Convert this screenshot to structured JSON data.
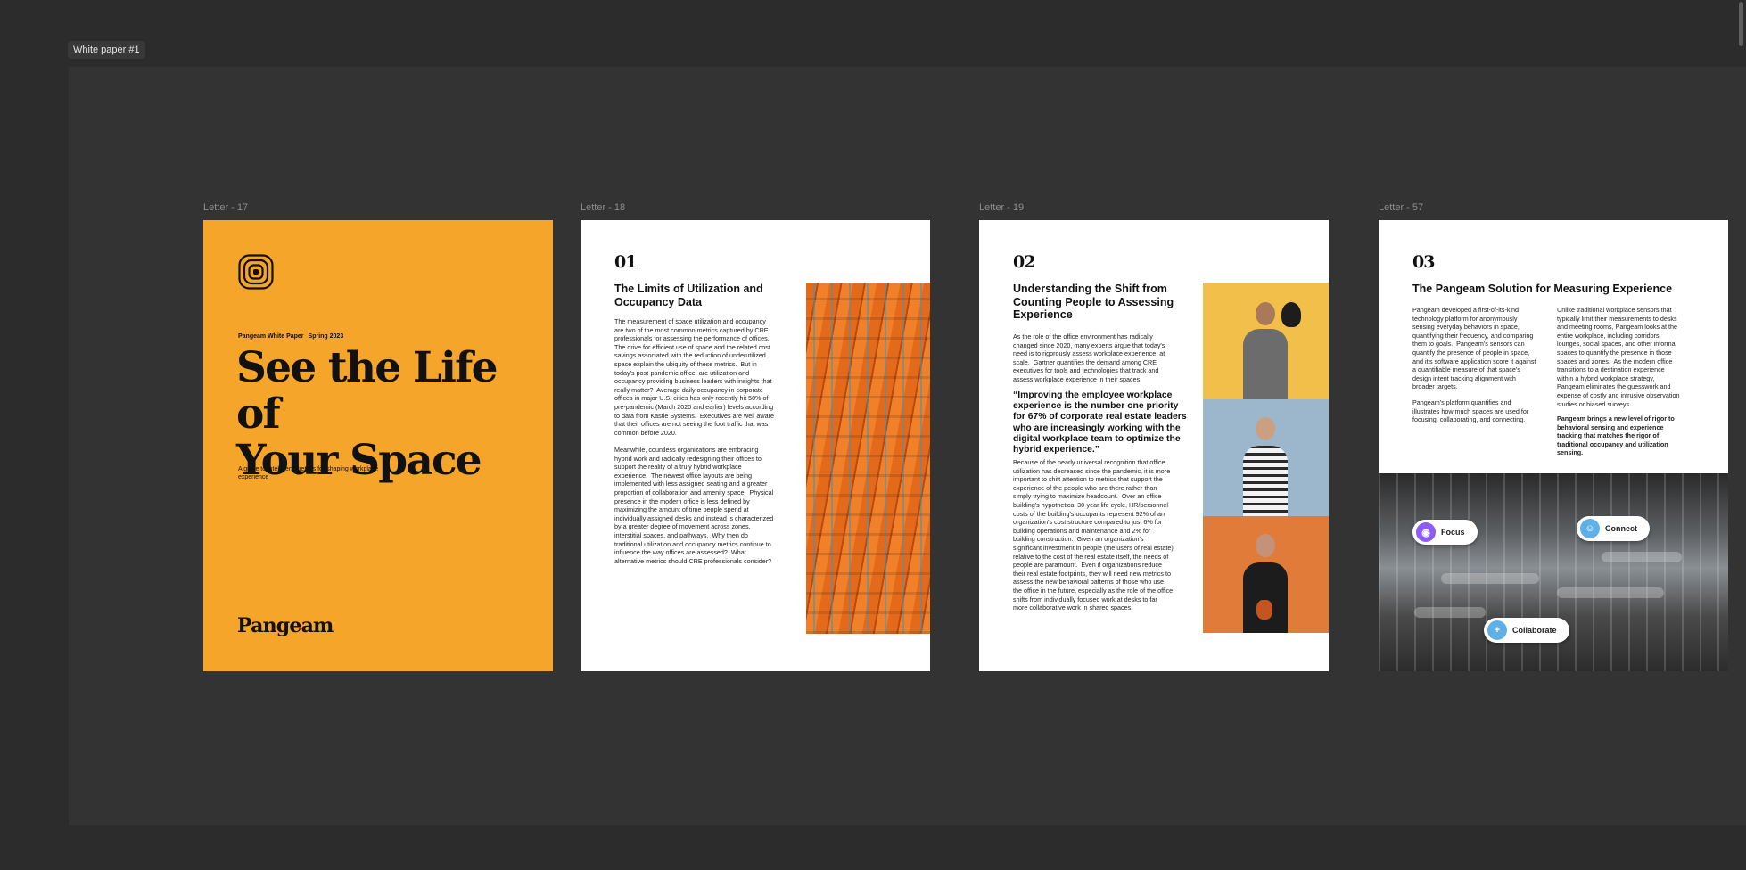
{
  "frame": {
    "label": "White paper #1"
  },
  "pages": [
    {
      "label": "Letter - 17"
    },
    {
      "label": "Letter - 18"
    },
    {
      "label": "Letter - 19"
    },
    {
      "label": "Letter - 57"
    }
  ],
  "cover": {
    "kicker_left": "Pangeam White Paper",
    "kicker_right": "Spring 2023",
    "title_line1": "See the Life of",
    "title_line2": "Your Space",
    "subtitle": "A guide to intelligent metrics for shaping workplace experience",
    "brand": "Pangeam",
    "background": "#f5a52a"
  },
  "page18": {
    "number": "01",
    "heading": "The Limits of Utilization and\nOccupancy Data",
    "para1": "The measurement of space utilization and occupancy\nare two of the most common metrics captured by CRE\nprofessionals for assessing the performance of offices.\nThe drive for efficient use of space and the related cost\nsavings associated with the reduction of underutilized\nspace explain the ubiquity of these metrics.  But in\ntoday's post-pandemic office, are utilization and\noccupancy providing business leaders with insights that\nreally matter?  Average daily occupancy in corporate\noffices in major U.S. cities has only recently hit 50% of\npre-pandemic (March 2020 and earlier) levels according\nto data from Kastle Systems.  Executives are well aware\nthat their offices are not seeing the foot traffic that was\ncommon before 2020.",
    "para2": "Meanwhile, countless organizations are embracing\nhybrid work and radically redesigning their offices to\nsupport the reality of a truly hybrid workplace\nexperience.  The newest office layouts are being\nimplemented with less assigned seating and a greater\nproportion of collaboration and amenity space.  Physical\npresence in the modern office is less defined by\nmaximizing the amount of time people spend at\nindividually assigned desks and instead is characterized\nby a greater degree of movement across zones,\ninterstitial spaces, and pathways.  Why then do\ntraditional utilization and occupancy metrics continue to\ninfluence the way offices are assessed?  What\nalternative metrics should CRE professionals consider?"
  },
  "page19": {
    "number": "02",
    "heading": "Understanding the Shift from\nCounting People to Assessing\nExperience",
    "para1": "As the role of the office environment has radically\nchanged since 2020, many experts argue that today's\nneed is to rigorously assess workplace experience, at\nscale.  Gartner quantifies the demand among CRE\nexecutives for tools and technologies that track and\nassess workplace experience in their spaces.",
    "quote": "“Improving the employee workplace\nexperience is the number one priority\nfor 67% of corporate real estate leaders\nwho are increasingly working with the\ndigital workplace team to optimize the\nhybrid experience.”",
    "para2": "Because of the nearly universal recognition that office\nutilization has decreased since the pandemic, it is more\nimportant to shift attention to metrics that support the\nexperience of the people who are there rather than\nsimply trying to maximize headcount.  Over an office\nbuilding's hypothetical 30-year life cycle, HR/personnel\ncosts of the building's occupants represent 92% of an\norganization's cost structure compared to just 6% for\nbuilding operations and maintenance and 2% for\nbuilding construction.  Given an organization's\nsignificant investment in people (the users of real estate)\nrelative to the cost of the real estate itself, the needs of\npeople are paramount.  Even if organizations reduce\ntheir real estate footprints, they will need new metrics to\nassess the new behavioral patterns of those who use\nthe office in the future, especially as the role of the office\nshifts from individually focused work at desks to far\nmore collaborative work in shared spaces."
  },
  "page57": {
    "number": "03",
    "heading": "The Pangeam Solution for Measuring Experience",
    "col1_p1": "Pangeam developed a first-of-its-kind\ntechnology platform for anonymously\nsensing everyday behaviors in space,\nquantifying their frequency, and comparing\nthem to goals.  Pangeam's sensors can\nquantify the presence of people in space,\nand it's software application score it against\na quantifiable measure of that space's\ndesign intent tracking alignment with\nbroader targets.",
    "col1_p2": "Pangeam's platform quantifies and\nillustrates how much spaces are used for\nfocusing, collaborating, and connecting.",
    "col2_p1": "Unlike traditional workplace sensors that\ntypically limit their measurements to desks\nand meeting rooms, Pangeam looks at the\nentire workplace, including corridors,\nlounges, social spaces, and other informal\nspaces to quantify the presence in those\nspaces and zones.  As the modern office\ntransitions to a destination experience\nwithin a hybrid workplace strategy,\nPangeam eliminates the guesswork and\nexpense of costly and intrusive observation\nstudies or biased surveys.",
    "col2_p2": "Pangeam brings a new level of rigor to\nbehavioral sensing and experience\ntracking that matches the rigor of\ntraditional occupancy and utilization\nsensing.",
    "pills": {
      "focus": "Focus",
      "connect": "Connect",
      "collaborate": "Collaborate"
    }
  }
}
